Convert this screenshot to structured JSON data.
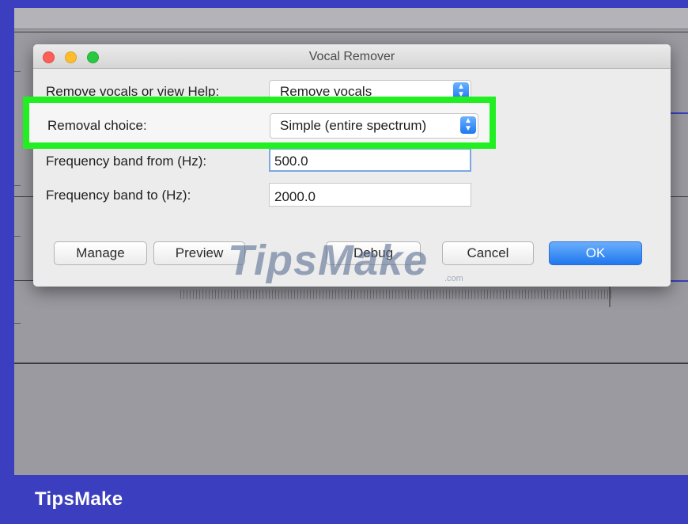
{
  "dialog": {
    "title": "Vocal Remover",
    "fields": {
      "remove_or_help": {
        "label": "Remove vocals or view Help:",
        "value": "Remove vocals"
      },
      "removal_choice": {
        "label": "Removal choice:",
        "value": "Simple (entire spectrum)"
      },
      "band_from": {
        "label": "Frequency band from (Hz):",
        "value": "500.0"
      },
      "band_to": {
        "label": "Frequency band to (Hz):",
        "value": "2000.0"
      }
    },
    "buttons": {
      "manage": "Manage",
      "preview": "Preview",
      "debug": "Debug",
      "cancel": "Cancel",
      "ok": "OK"
    }
  },
  "watermark": {
    "text": "TipsMake",
    "suffix": ".com"
  },
  "brand": {
    "name": "TipsMake"
  },
  "colors": {
    "frame": "#3b3fbf",
    "highlight": "#22ef22",
    "ok_button": "#1f78ee",
    "close_button": "#fc5f57",
    "minimize_button": "#fdbd2e",
    "zoom_button": "#28c940"
  },
  "icons": {
    "select_arrows": "up-down-chevron-icon"
  }
}
